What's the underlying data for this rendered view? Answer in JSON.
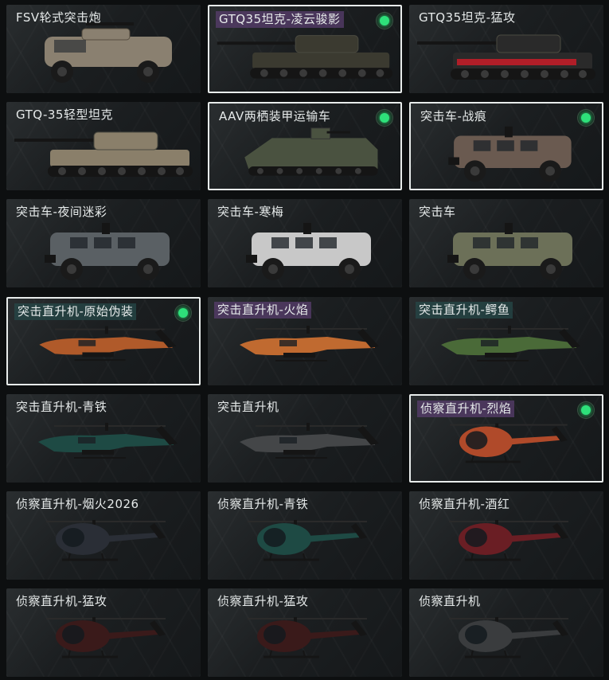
{
  "cards": [
    {
      "label": "FSV轮式突击炮",
      "selected": false,
      "equipped": false,
      "kind": "wheeled-gun",
      "color": "#8a8070",
      "hl": ""
    },
    {
      "label": "GTQ35坦克-凌云骏影",
      "selected": true,
      "equipped": true,
      "kind": "tank",
      "color": "#3b3a30",
      "hl": "purple"
    },
    {
      "label": "GTQ35坦克-猛攻",
      "selected": false,
      "equipped": false,
      "kind": "tank-red",
      "color": "#2a2a2a",
      "hl": ""
    },
    {
      "label": "GTQ-35轻型坦克",
      "selected": false,
      "equipped": false,
      "kind": "tank",
      "color": "#8a7f6a",
      "hl": ""
    },
    {
      "label": "AAV两栖装甲运输车",
      "selected": true,
      "equipped": true,
      "kind": "aav",
      "color": "#4a5240",
      "hl": ""
    },
    {
      "label": "突击车-战痕",
      "selected": true,
      "equipped": true,
      "kind": "truck",
      "color": "#6a5a50",
      "hl": ""
    },
    {
      "label": "突击车-夜间迷彩",
      "selected": false,
      "equipped": false,
      "kind": "truck",
      "color": "#5a6064",
      "hl": ""
    },
    {
      "label": "突击车-寒梅",
      "selected": false,
      "equipped": false,
      "kind": "truck",
      "color": "#c8c8c8",
      "hl": ""
    },
    {
      "label": "突击车",
      "selected": false,
      "equipped": false,
      "kind": "truck",
      "color": "#6c7058",
      "hl": ""
    },
    {
      "label": "突击直升机-原始伪装",
      "selected": true,
      "equipped": true,
      "kind": "apache",
      "color": "#b05a2a",
      "hl": "teal"
    },
    {
      "label": "突击直升机-火焰",
      "selected": false,
      "equipped": false,
      "kind": "apache",
      "color": "#c06a30",
      "hl": "purple"
    },
    {
      "label": "突击直升机-鳄鱼",
      "selected": false,
      "equipped": false,
      "kind": "apache",
      "color": "#4a6a38",
      "hl": "teal"
    },
    {
      "label": "突击直升机-青铁",
      "selected": false,
      "equipped": false,
      "kind": "apache",
      "color": "#1e4a44",
      "hl": ""
    },
    {
      "label": "突击直升机",
      "selected": false,
      "equipped": false,
      "kind": "apache",
      "color": "#444648",
      "hl": ""
    },
    {
      "label": "侦察直升机-烈焰",
      "selected": true,
      "equipped": true,
      "kind": "scout",
      "color": "#b04a2a",
      "hl": "purple"
    },
    {
      "label": "侦察直升机-烟火2026",
      "selected": false,
      "equipped": false,
      "kind": "scout",
      "color": "#2a2e36",
      "hl": ""
    },
    {
      "label": "侦察直升机-青铁",
      "selected": false,
      "equipped": false,
      "kind": "scout",
      "color": "#1e4a44",
      "hl": ""
    },
    {
      "label": "侦察直升机-酒红",
      "selected": false,
      "equipped": false,
      "kind": "scout",
      "color": "#6a1e24",
      "hl": ""
    },
    {
      "label": "侦察直升机-猛攻",
      "selected": false,
      "equipped": false,
      "kind": "scout",
      "color": "#3a1a1a",
      "hl": ""
    },
    {
      "label": "侦察直升机-猛攻",
      "selected": false,
      "equipped": false,
      "kind": "scout",
      "color": "#3a1a1a",
      "hl": ""
    },
    {
      "label": "侦察直升机",
      "selected": false,
      "equipped": false,
      "kind": "scout",
      "color": "#3a3c3e",
      "hl": ""
    }
  ]
}
